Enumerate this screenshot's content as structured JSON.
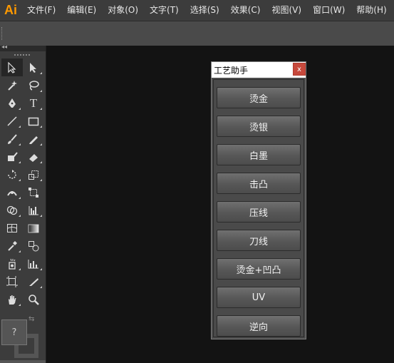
{
  "app": {
    "logo": "Ai"
  },
  "menu": {
    "items": [
      {
        "label": "文件(F)"
      },
      {
        "label": "编辑(E)"
      },
      {
        "label": "对象(O)"
      },
      {
        "label": "文字(T)"
      },
      {
        "label": "选择(S)"
      },
      {
        "label": "效果(C)"
      },
      {
        "label": "视图(V)"
      },
      {
        "label": "窗口(W)"
      },
      {
        "label": "帮助(H)"
      }
    ]
  },
  "tools": {
    "text_tool_glyph": "T",
    "color_area": {
      "unknown_glyph": "?"
    },
    "colors": {
      "fill": "#555555",
      "stroke": "#555555"
    }
  },
  "dialog": {
    "title": "工艺助手",
    "close_label": "x",
    "buttons": [
      {
        "label": "烫金"
      },
      {
        "label": "烫银"
      },
      {
        "label": "白墨"
      },
      {
        "label": "击凸"
      },
      {
        "label": "压线"
      },
      {
        "label": "刀线"
      },
      {
        "label": "烫金+凹凸"
      },
      {
        "label": "UV"
      },
      {
        "label": "逆向"
      }
    ]
  },
  "colors": {
    "menubar_bg": "#3c3c3c",
    "canvas_bg": "#131313",
    "logo_orange": "#ff9a00",
    "close_red": "#c7493c"
  }
}
